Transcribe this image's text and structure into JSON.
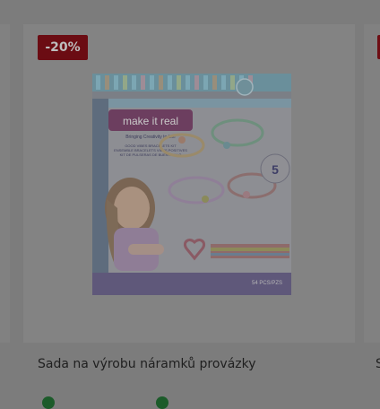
{
  "product": {
    "discount_badge": "-20%",
    "title": "Sada na výrobu náramků provázky",
    "image_alt": "make it real bracelet kit",
    "box": {
      "brand": "make it real",
      "tagline": "Bringing Creativity to Life",
      "subtitle_lines": [
        "GOOD VIBES BRACELETS KIT",
        "ENSEMBLE BRACELETS VIBES POSITIVES",
        "KIT DE PULSERAS DE BUEN ROLLO"
      ],
      "count_badge": "5",
      "pcs": "54 PCS/PZS"
    }
  },
  "next_card": {
    "title_fragment": "S"
  },
  "colors": {
    "overlay": "#7c7c7c",
    "badge": "#6b0c13",
    "stock_dot": "#1c5b2a"
  }
}
